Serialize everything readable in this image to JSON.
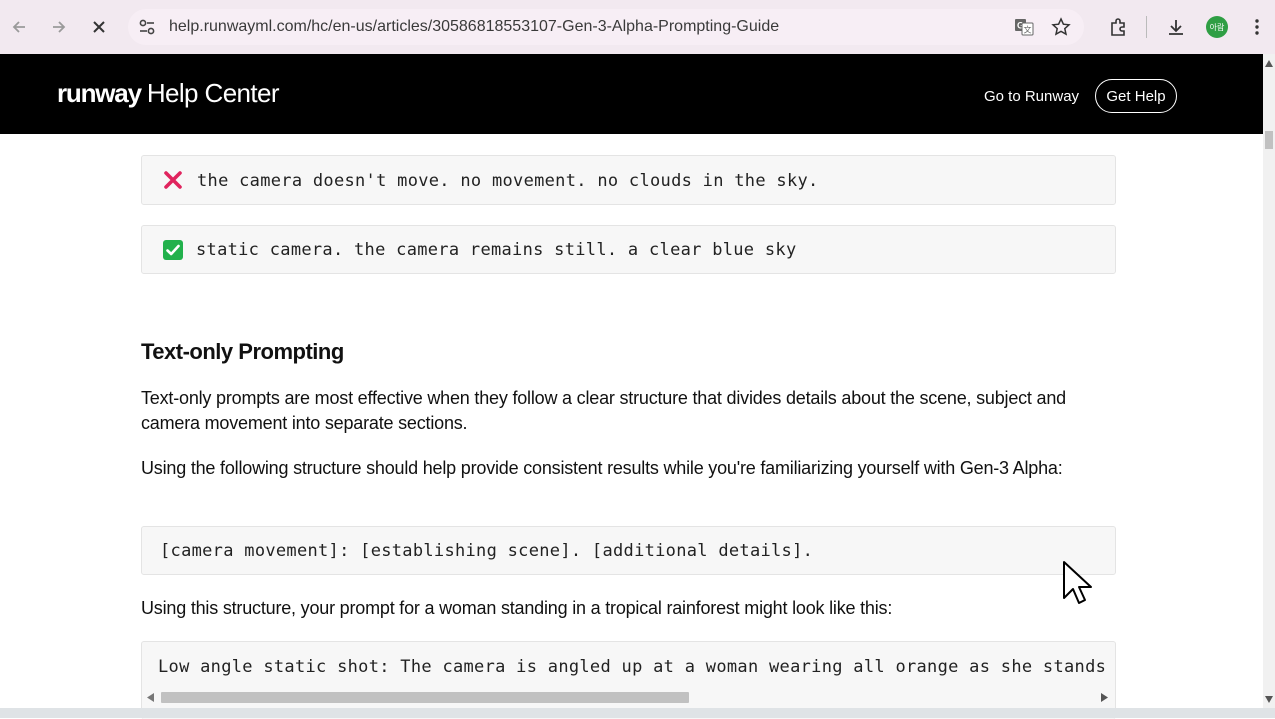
{
  "browser": {
    "url": "help.runwayml.com/hc/en-us/articles/30586818553107-Gen-3-Alpha-Prompting-Guide",
    "profile_initials": "아람",
    "colors": {
      "chrome_bg": "#f2e9f0",
      "profile_bg": "#2f9e44"
    }
  },
  "header": {
    "brand_word": "runway",
    "brand_suffix": "Help Center",
    "go_to_runway": "Go to Runway",
    "get_help": "Get Help"
  },
  "article": {
    "bad_example": "the camera doesn't move. no movement. no clouds in the sky.",
    "good_example": "static camera. the camera remains still. a clear blue sky",
    "heading": "Text-only Prompting",
    "para1": "Text-only prompts are most effective when they follow a clear structure that divides details about the scene, subject and camera movement into separate sections.",
    "para2": "Using the following structure should help provide consistent results while you're familiarizing yourself with Gen-3 Alpha:",
    "structure_code": "[camera movement]: [establishing scene]. [additional details].",
    "para3": "Using this structure, your prompt for a woman standing in a tropical rainforest might look like this:",
    "example_code": "Low angle static shot: The camera is angled up at a woman wearing all orange as she stands in a tro"
  },
  "colors": {
    "bad_icon": "#e0245e",
    "good_icon": "#22b14c",
    "header_bg": "#000000"
  },
  "icons": [
    "back-icon",
    "forward-icon",
    "stop-loading-icon",
    "site-settings-icon",
    "translate-icon",
    "star-icon",
    "extensions-icon",
    "download-icon",
    "more-menu-icon",
    "cross-mark-icon",
    "check-mark-icon",
    "cursor-icon"
  ]
}
